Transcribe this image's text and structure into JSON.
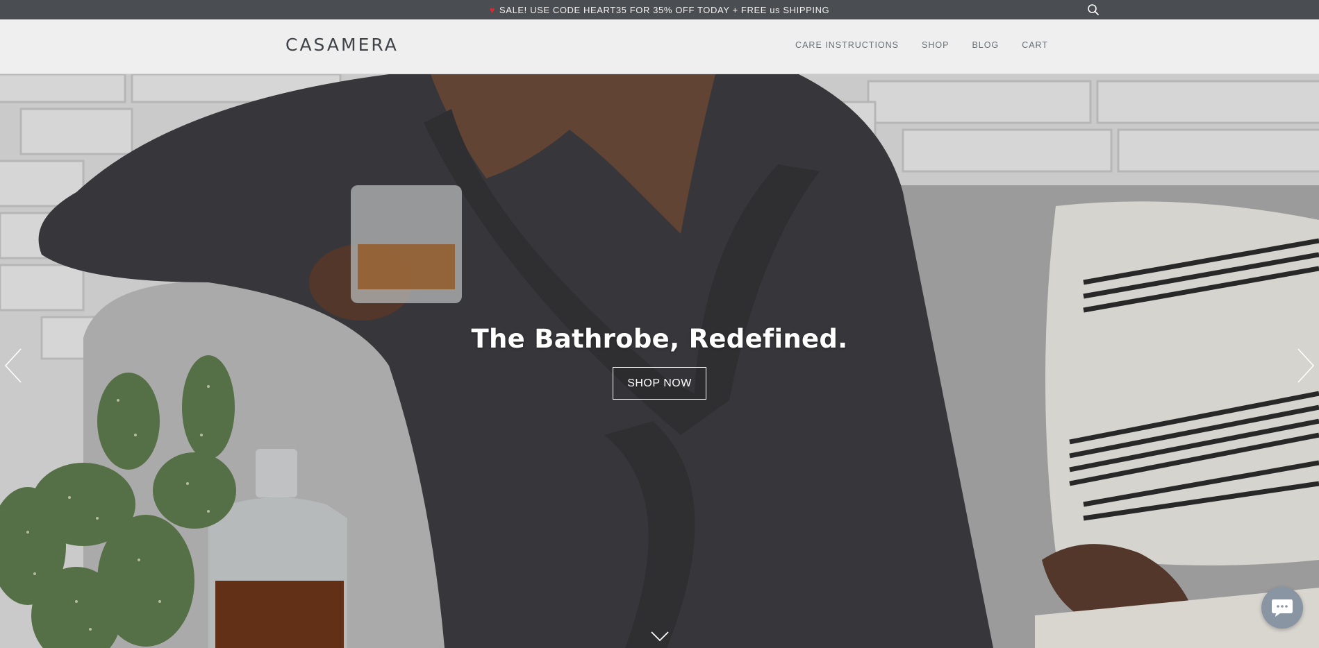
{
  "announcement": {
    "text": "SALE! USE CODE HEART35 FOR 35% OFF TODAY + FREE us SHIPPING",
    "heart_icon": "heart-icon",
    "heart_color": "#e0272f",
    "search_icon": "search-icon"
  },
  "header": {
    "logo": "CASAMERA",
    "nav": [
      {
        "label": "CARE INSTRUCTIONS"
      },
      {
        "label": "SHOP"
      },
      {
        "label": "BLOG"
      },
      {
        "label": "CART"
      }
    ]
  },
  "hero": {
    "title": "The Bathrobe, Redefined.",
    "button_label": "SHOP NOW",
    "prev_icon": "chevron-left-icon",
    "next_icon": "chevron-right-icon",
    "scroll_icon": "chevron-down-icon"
  },
  "chat": {
    "icon": "chat-icon"
  },
  "colors": {
    "announcement_bg": "#4a4d52",
    "header_bg": "#efefef",
    "robe": "#3c3c40"
  }
}
